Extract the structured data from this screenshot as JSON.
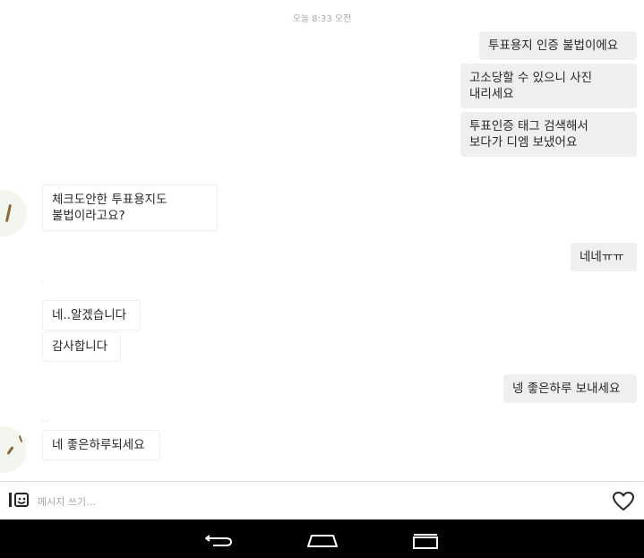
{
  "chat": {
    "timestamp": "오늘 8:33 오전",
    "messages": [
      {
        "side": "out",
        "text": "투표용지 인증 불법이에요"
      },
      {
        "side": "out",
        "lines": [
          "고소당할 수 있으니 사진",
          "내리세요"
        ]
      },
      {
        "side": "out",
        "lines": [
          "투표인증 태그 검색해서",
          "보다가 디엠 보냈어요"
        ]
      },
      {
        "side": "in",
        "lines": [
          "체크도안한 투표용지도",
          "불법이라고요?"
        ]
      },
      {
        "side": "out",
        "text": "네네ㅠㅠ"
      },
      {
        "side": "in",
        "text": "네..알겠습니다"
      },
      {
        "side": "in",
        "text": "감사합니다"
      },
      {
        "side": "out",
        "text": "넹 좋은하루 보내세요"
      },
      {
        "side": "in",
        "text": "네 좋은하루되세요"
      }
    ]
  },
  "composer": {
    "placeholder": "메시지 쓰기...",
    "camera_icon": "camera-icon",
    "heart_icon": "heart-icon"
  },
  "navbar": {
    "back_icon": "back-icon",
    "home_icon": "home-icon",
    "recents_icon": "recents-icon"
  },
  "colors": {
    "outgoing_bubble": "#efefef",
    "incoming_border": "#efefef",
    "navbar": "#000000"
  }
}
